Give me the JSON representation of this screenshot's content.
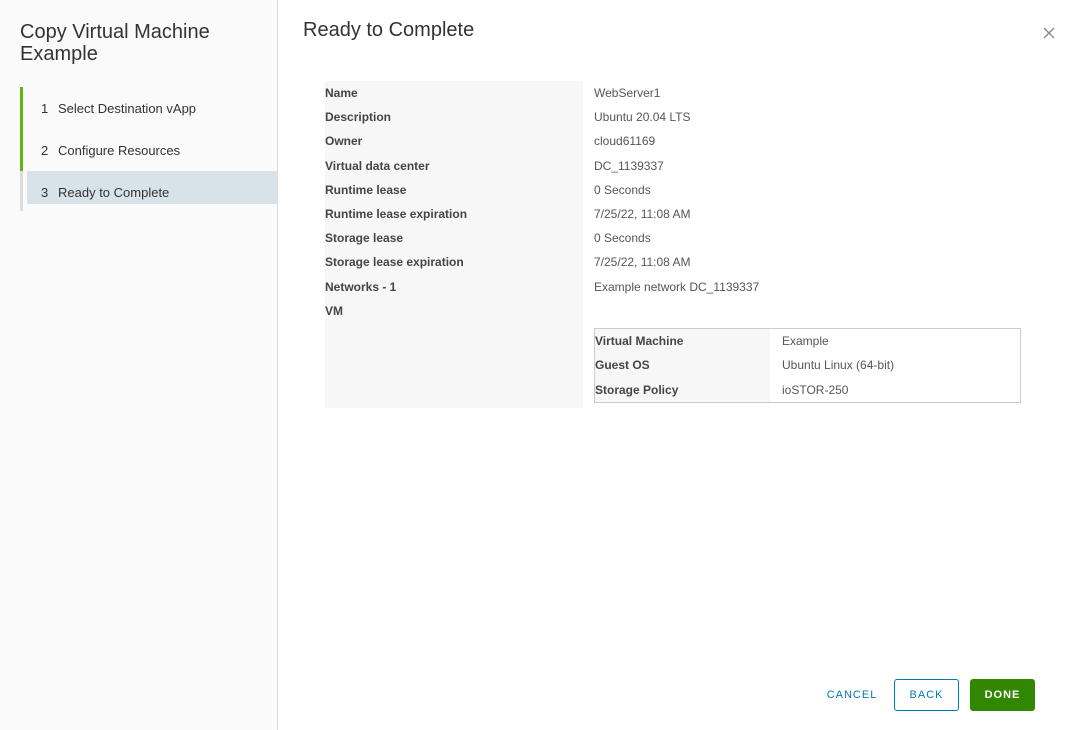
{
  "wizard": {
    "title": "Copy Virtual Machine Example",
    "steps": [
      {
        "number": "1",
        "label": "Select Destination vApp",
        "state": "done"
      },
      {
        "number": "2",
        "label": "Configure Resources",
        "state": "done"
      },
      {
        "number": "3",
        "label": "Ready to Complete",
        "state": "current"
      }
    ]
  },
  "page": {
    "title": "Ready to Complete",
    "close_icon": "close-icon"
  },
  "summary": {
    "rows": [
      {
        "key": "Name",
        "value": "WebServer1"
      },
      {
        "key": "Description",
        "value": "Ubuntu 20.04 LTS"
      },
      {
        "key": "Owner",
        "value": "cloud61169"
      },
      {
        "key": "Virtual data center",
        "value": "DC_1139337"
      },
      {
        "key": "Runtime lease",
        "value": "0 Seconds"
      },
      {
        "key": "Runtime lease expiration",
        "value": "7/25/22, 11:08 AM"
      },
      {
        "key": "Storage lease",
        "value": "0 Seconds"
      },
      {
        "key": "Storage lease expiration",
        "value": "7/25/22, 11:08 AM"
      },
      {
        "key": "Networks - 1",
        "value": "Example network DC_1139337"
      },
      {
        "key": "VM",
        "value": ""
      }
    ],
    "vm": [
      {
        "key": "Virtual Machine",
        "value": "Example"
      },
      {
        "key": "Guest OS",
        "value": "Ubuntu Linux (64-bit)"
      },
      {
        "key": "Storage Policy",
        "value": "ioSTOR-250"
      }
    ]
  },
  "footer": {
    "cancel_label": "CANCEL",
    "back_label": "BACK",
    "done_label": "DONE"
  },
  "colors": {
    "step_done": "#60b515",
    "step_current_bg": "#d8e3e9",
    "primary_blue": "#0079b8",
    "done_green": "#318700"
  }
}
